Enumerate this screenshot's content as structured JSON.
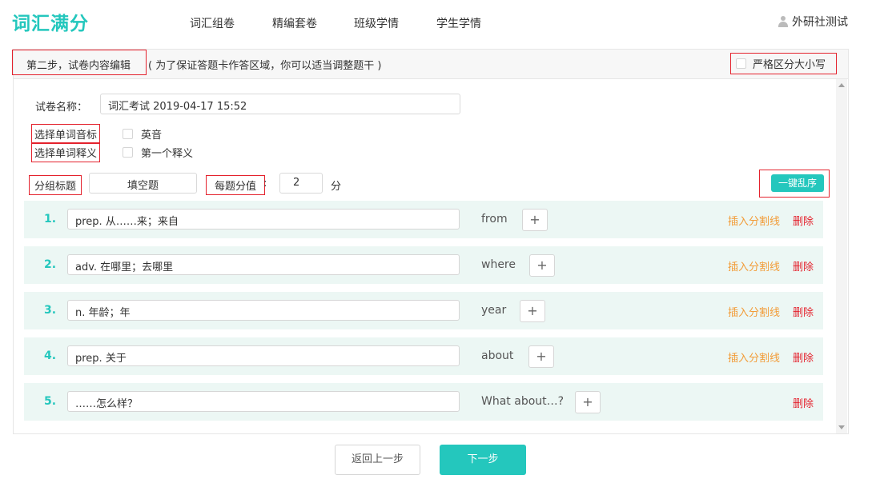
{
  "app": {
    "logo": "词汇满分"
  },
  "nav": {
    "items": [
      "词汇组卷",
      "精编套卷",
      "班级学情",
      "学生学情"
    ]
  },
  "user": {
    "name": "外研社测试"
  },
  "step": {
    "title": "第二步，试卷内容编辑",
    "hint": "( 为了保证答题卡作答区域，你可以适当调整题干 )",
    "case_sensitive_label": "严格区分大小写"
  },
  "form": {
    "name_label": "试卷名称：",
    "name_value": "词汇考试 2019-04-17 15:52",
    "phonetic_label": "选择单词音标",
    "phonetic_option": "英音",
    "meaning_label": "选择单词释义",
    "meaning_option": "第一个释义",
    "group_title_label": "分组标题",
    "group_title_value": "填空题",
    "score_label": "每题分值",
    "score_colon": ":",
    "score_value": "2",
    "score_unit": "分",
    "shuffle_label": "一键乱序"
  },
  "questions": [
    {
      "num": "1.",
      "text": "prep. 从……来；来自",
      "word": "from",
      "insert": "插入分割线",
      "delete": "删除"
    },
    {
      "num": "2.",
      "text": "adv. 在哪里；去哪里",
      "word": "where",
      "insert": "插入分割线",
      "delete": "删除"
    },
    {
      "num": "3.",
      "text": "n. 年龄；年",
      "word": "year",
      "insert": "插入分割线",
      "delete": "删除"
    },
    {
      "num": "4.",
      "text": "prep. 关于",
      "word": "about",
      "insert": "插入分割线",
      "delete": "删除"
    },
    {
      "num": "5.",
      "text": "……怎么样？",
      "word": "What about…?",
      "insert": "",
      "delete": "删除"
    }
  ],
  "plus_symbol": "+",
  "footer": {
    "back_label": "返回上一步",
    "next_label": "下一步"
  },
  "colors": {
    "accent": "#24c7bd",
    "highlight_border": "#e4222d",
    "insert_link": "#f29c38",
    "delete_link": "#e4222d"
  }
}
